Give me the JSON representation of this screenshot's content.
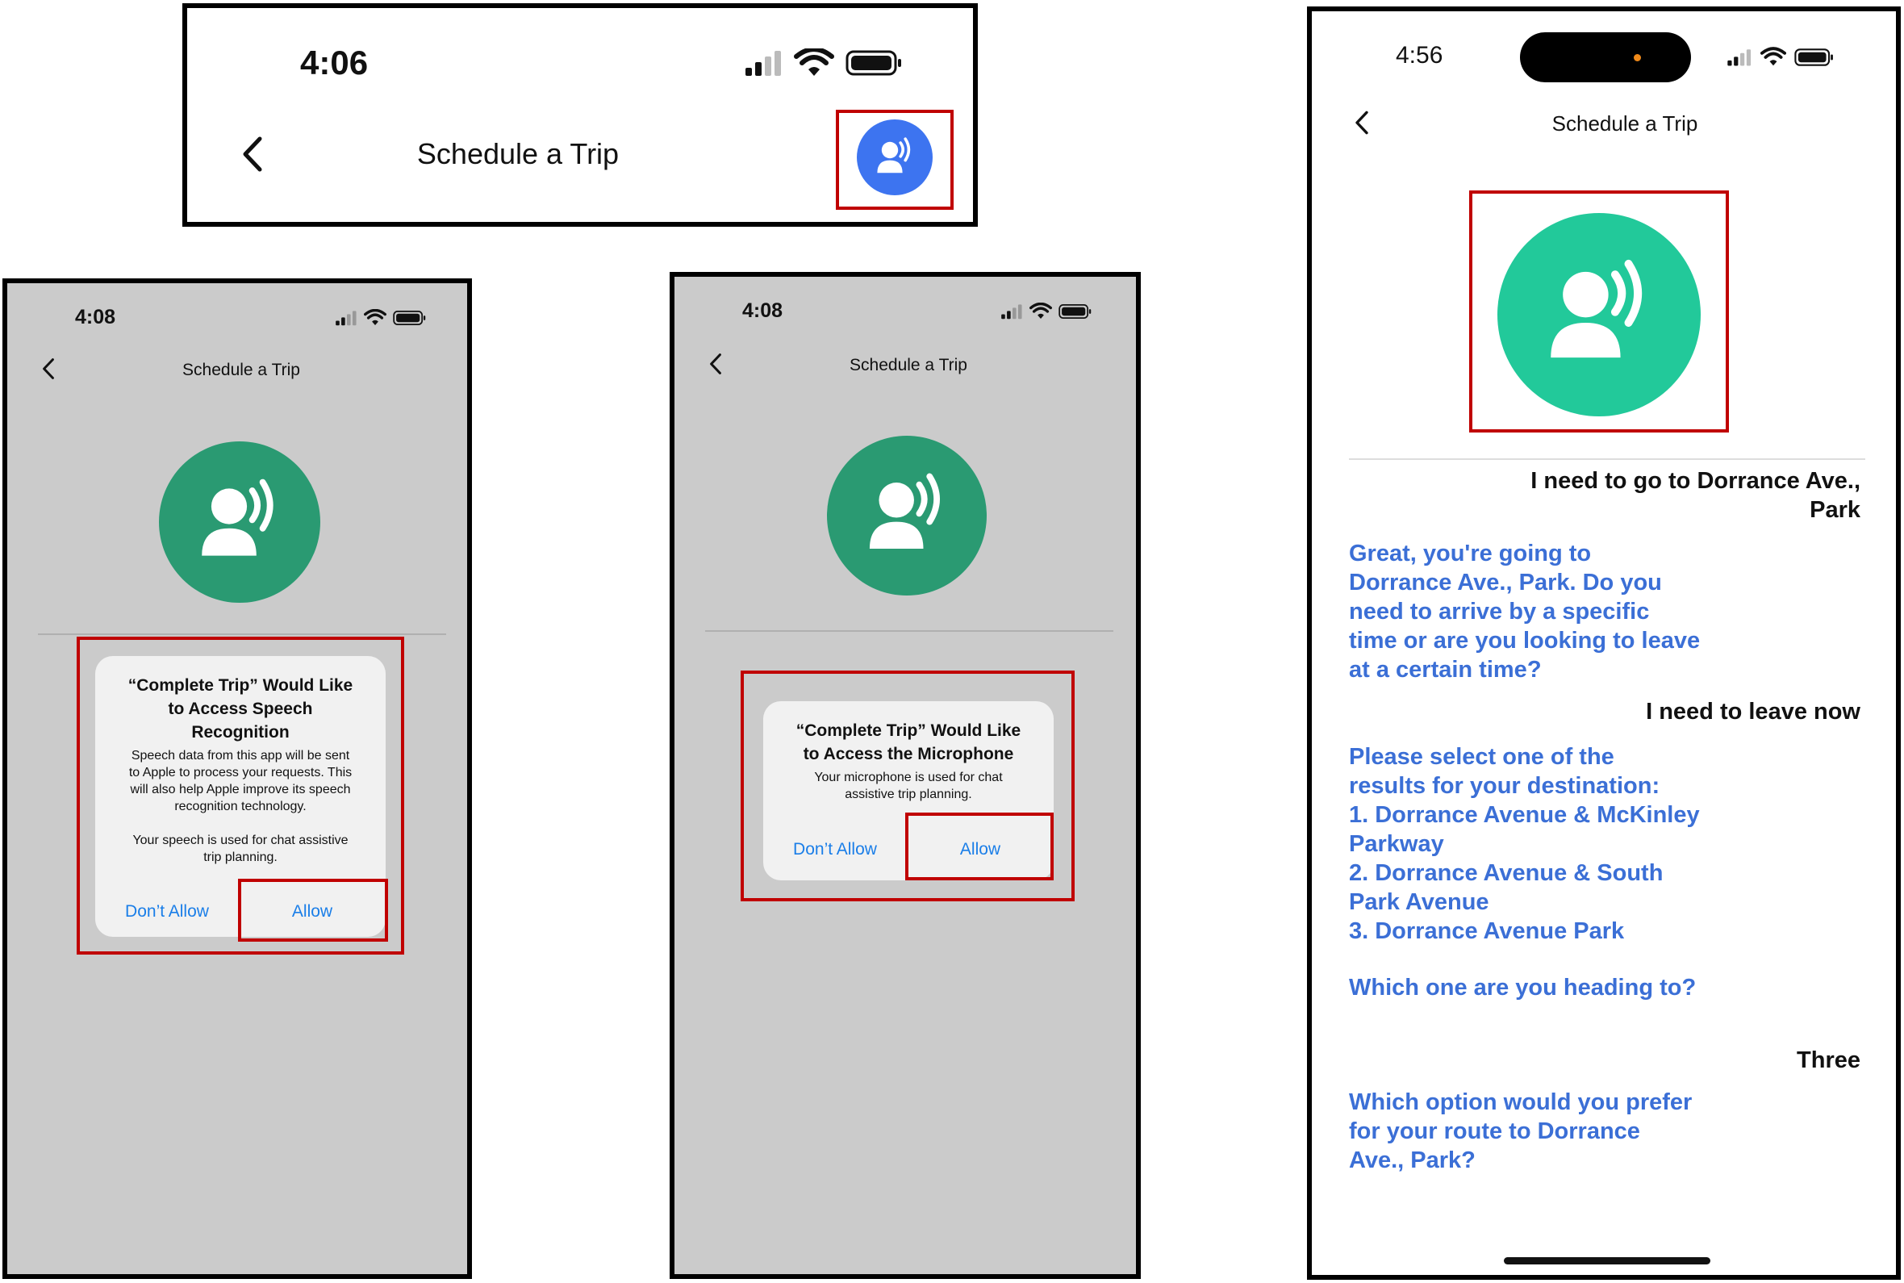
{
  "common": {
    "screen_title": "Schedule a Trip",
    "dont_allow": "Don’t Allow",
    "allow": "Allow"
  },
  "panel_header": {
    "time": "4:06"
  },
  "panel_speech": {
    "time": "4:08",
    "dialog_title_lines": [
      "“Complete Trip” Would Like",
      "to Access Speech",
      "Recognition"
    ],
    "dialog_msg_lines": [
      "Speech data from this app will be sent",
      "to Apple to process your requests. This",
      "will also help Apple improve its speech",
      "recognition technology."
    ],
    "dialog_msg2_lines": [
      "Your speech is used for chat assistive",
      "trip planning."
    ]
  },
  "panel_mic": {
    "time": "4:08",
    "dialog_title_lines": [
      "“Complete Trip” Would Like",
      "to Access the Microphone"
    ],
    "dialog_msg_lines": [
      "Your microphone is used for chat",
      "assistive trip planning."
    ]
  },
  "panel_chat": {
    "time": "4:56",
    "messages": [
      {
        "from": "user",
        "lines": [
          "I need to go to Dorrance Ave.,",
          "Park"
        ]
      },
      {
        "from": "bot",
        "lines": [
          "Great, you're going to",
          "Dorrance Ave., Park. Do you",
          "need to arrive by a specific",
          "time or are you looking to leave",
          "at a certain time?"
        ]
      },
      {
        "from": "user",
        "lines": [
          "I need to leave now"
        ]
      },
      {
        "from": "bot",
        "lines": [
          "Please select one of the",
          "results for your destination:",
          "1. Dorrance Avenue & McKinley",
          "Parkway",
          "2. Dorrance Avenue & South",
          "Park Avenue",
          "3. Dorrance Avenue Park",
          "",
          "Which one are you heading to?"
        ]
      },
      {
        "from": "user",
        "lines": [
          "Three"
        ]
      },
      {
        "from": "bot",
        "lines": [
          "Which option would you prefer",
          "for your route to Dorrance",
          "Ave., Park?"
        ]
      }
    ]
  },
  "colors": {
    "header_avatar": "#3d74f0",
    "avatar_green_dark": "#2a9a72",
    "avatar_green_bright": "#22c99a",
    "highlight_red": "#c00000",
    "bot_text": "#3b6fd6",
    "link_blue": "#1a7ee8"
  },
  "icons": [
    "chevron-left-icon",
    "signal-icon",
    "wifi-icon",
    "battery-icon",
    "voice-assistant-icon",
    "dynamic-island-icon"
  ]
}
